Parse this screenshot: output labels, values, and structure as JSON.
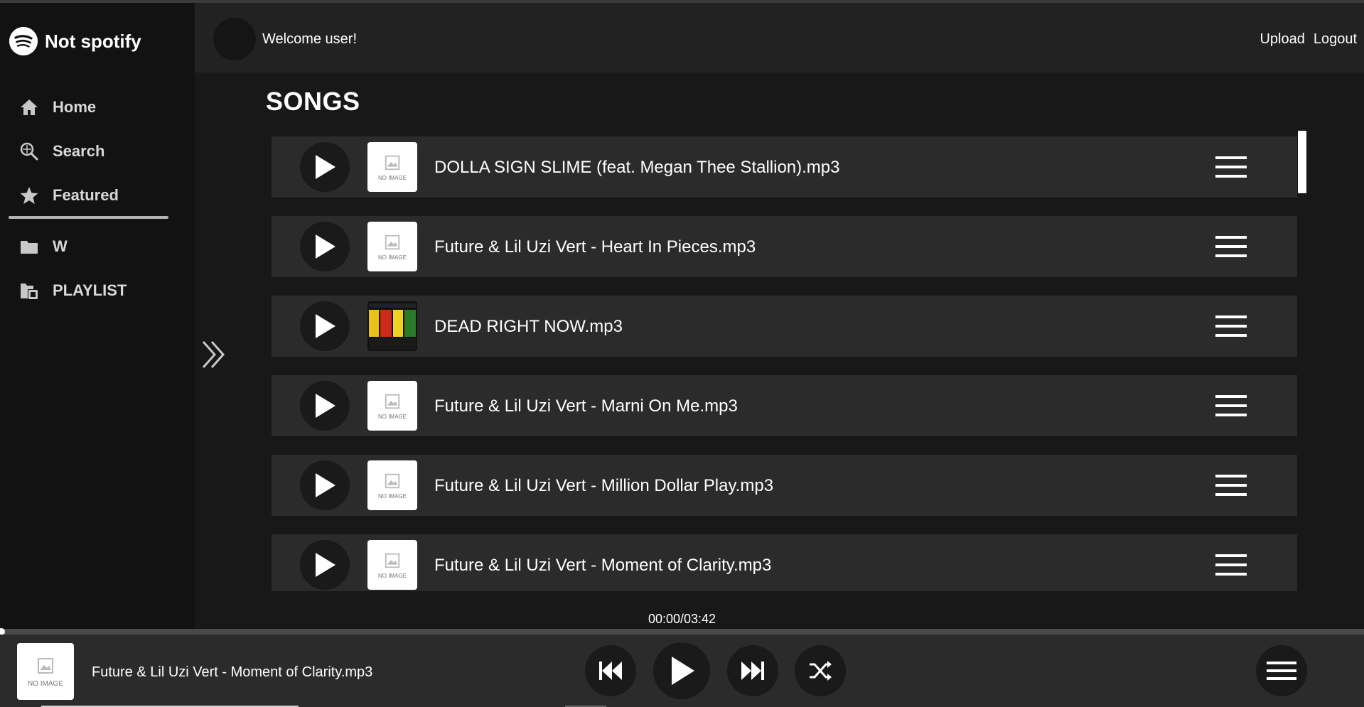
{
  "app": {
    "name": "Not spotify"
  },
  "sidebar": {
    "items": [
      {
        "label": "Home",
        "icon": "home-icon"
      },
      {
        "label": "Search",
        "icon": "search-icon"
      },
      {
        "label": "Featured",
        "icon": "star-icon"
      }
    ],
    "playlists": [
      {
        "label": "W",
        "icon": "folder-icon"
      },
      {
        "label": "PLAYLIST",
        "icon": "playlist-folder-icon"
      }
    ]
  },
  "header": {
    "welcome": "Welcome user!",
    "upload": "Upload",
    "logout": "Logout"
  },
  "main": {
    "title": "SONGS",
    "no_image_text": "NO IMAGE",
    "songs": [
      {
        "title": "DOLLA SIGN SLIME (feat. Megan Thee Stallion).mp3",
        "has_cover": false
      },
      {
        "title": "Future & Lil Uzi Vert - Heart In Pieces.mp3",
        "has_cover": false
      },
      {
        "title": "DEAD RIGHT NOW.mp3",
        "has_cover": true
      },
      {
        "title": "Future & Lil Uzi Vert - Marni On Me.mp3",
        "has_cover": false
      },
      {
        "title": "Future & Lil Uzi Vert - Million Dollar Play.mp3",
        "has_cover": false
      },
      {
        "title": "Future & Lil Uzi Vert - Moment of Clarity.mp3",
        "has_cover": false
      }
    ]
  },
  "player": {
    "time": "00:00/03:42",
    "progress": 0,
    "now_playing": "Future & Lil Uzi Vert - Moment of Clarity.mp3",
    "no_image_text": "NO IMAGE"
  },
  "colors": {
    "background": "#121212",
    "header": "#222222",
    "main": "#181818",
    "row": "#2b2b2b",
    "button": "#1a1a1a"
  }
}
